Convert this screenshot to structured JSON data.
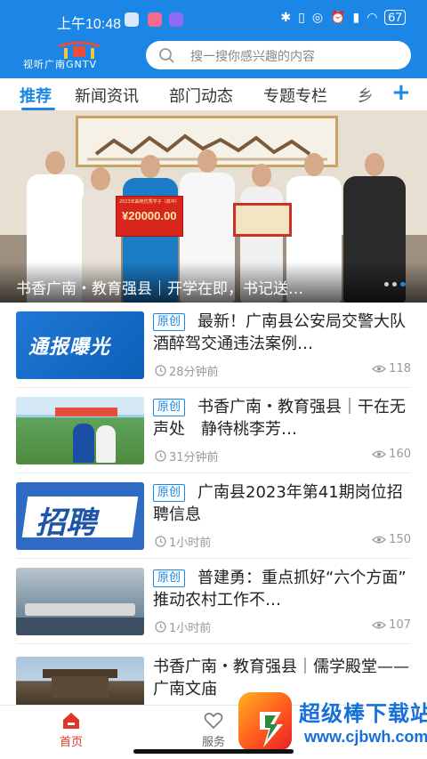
{
  "status_bar": {
    "time": "上午10:48",
    "battery": "67"
  },
  "header": {
    "logo_text": "视听广南GNTV",
    "search_placeholder": "搜一搜你感兴趣的内容",
    "brand_color": "#1b86e6"
  },
  "tabs": [
    {
      "label": "推荐",
      "active": true
    },
    {
      "label": "新闻资讯",
      "active": false
    },
    {
      "label": "部门动态",
      "active": false
    },
    {
      "label": "专题专栏",
      "active": false
    },
    {
      "label": "乡",
      "active": false
    }
  ],
  "tab_add_label": "+",
  "banner": {
    "caption": "书香广南・教育强县｜开学在即，书记送…",
    "check_amount": "¥20000.00",
    "check_title": "2023年曲苑优秀学子（高中）",
    "dots_count": 3,
    "active_dot": 2
  },
  "news": [
    {
      "badge": "原创",
      "title": "最新！广南县公安局交警大队酒醉驾交通违法案例…",
      "time": "28分钟前",
      "views": "118",
      "thumb_text": "通报曝光"
    },
    {
      "badge": "原创",
      "title": "书香广南・教育强县｜干在无声处　静待桃李芳…",
      "time": "31分钟前",
      "views": "160",
      "thumb_text": ""
    },
    {
      "badge": "原创",
      "title": "广南县2023年第41期岗位招聘信息",
      "time": "1小时前",
      "views": "150",
      "thumb_text": "招聘"
    },
    {
      "badge": "原创",
      "title": "普建勇：重点抓好“六个方面”　推动农村工作不…",
      "time": "1小时前",
      "views": "107",
      "thumb_text": ""
    },
    {
      "badge": "",
      "title": "书香广南・教育强县｜儒学殿堂——广南文庙",
      "time": "",
      "views": "",
      "thumb_text": ""
    }
  ],
  "bottom_nav": [
    {
      "label": "首页",
      "icon": "home-icon",
      "active": true
    },
    {
      "label": "服务",
      "icon": "heart-icon",
      "active": false
    }
  ],
  "watermark": {
    "title": "超级棒下载站",
    "url": "www.cjbwh.com"
  }
}
